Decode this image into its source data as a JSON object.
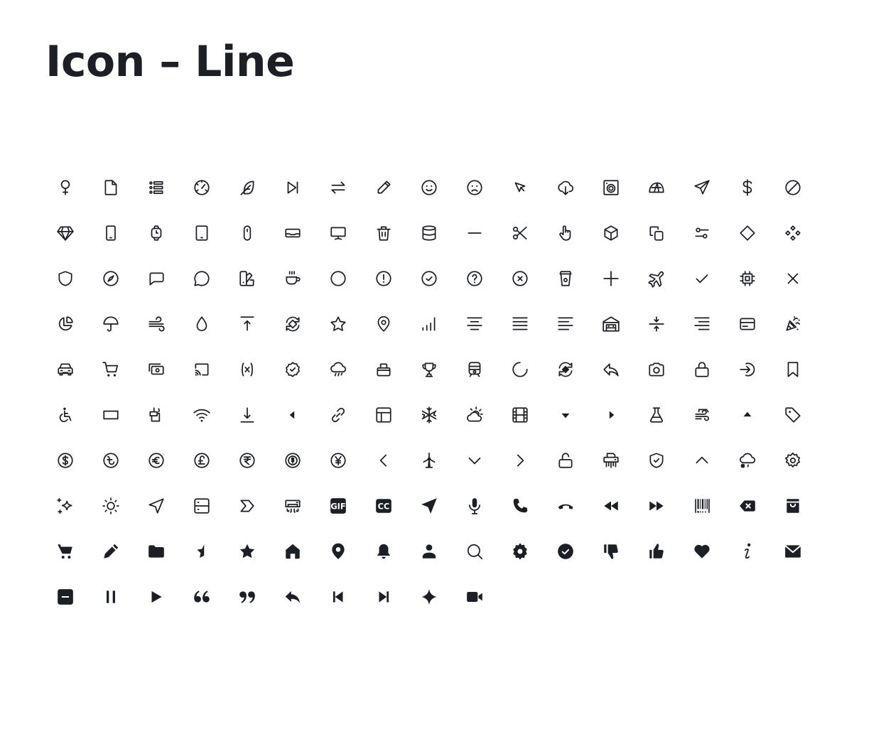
{
  "page": {
    "title": "Icon – Line"
  },
  "icons": [
    "female",
    "file",
    "list",
    "speedometer",
    "feather",
    "skip-forward",
    "transfer",
    "pencil",
    "smile",
    "frown",
    "cursor",
    "cloud-download",
    "washing-machine",
    "tent",
    "send",
    "dollar",
    "forbidden",
    "diamond-gem",
    "smartphone",
    "smartwatch",
    "tablet",
    "mouse",
    "inbox-tray",
    "monitor",
    "trash",
    "database",
    "minus",
    "scissors",
    "hand-pointer",
    "cube",
    "copy",
    "sliders",
    "rhombus",
    "apps-grid",
    "shield",
    "compass",
    "message-square",
    "message-circle",
    "swatch-book",
    "coffee-cup",
    "circle",
    "alert-circle",
    "check-circle",
    "help-circle",
    "x-circle",
    "takeaway-cup",
    "plus",
    "airplane",
    "check",
    "cpu-chip",
    "x",
    "pie-chart",
    "umbrella",
    "wind",
    "droplet",
    "upload-top",
    "sync-diamond",
    "star",
    "map-pin",
    "signal-bars",
    "align-center",
    "align-justify",
    "align-left",
    "garage",
    "collapse-vertical",
    "align-right",
    "credit-card",
    "party-popper",
    "car",
    "shopping-cart",
    "money-cash",
    "screencast",
    "variable",
    "verified-badge",
    "rain-cloud",
    "bag",
    "trophy",
    "train",
    "loader",
    "sync-grid",
    "reply",
    "camera",
    "lock",
    "login",
    "bookmark",
    "wheelchair",
    "rectangle",
    "drawer-pot",
    "wifi",
    "download-bottom",
    "caret-left",
    "link",
    "layout",
    "snowflake",
    "partly-sunny",
    "film",
    "caret-down",
    "caret-right",
    "beaker",
    "wind-line",
    "caret-up",
    "tag",
    "dollar-circle",
    "taka-circle",
    "euro-circle",
    "pound-circle",
    "rupee-circle",
    "dollar-exchange",
    "yen-circle",
    "chevron-left",
    "wind-turbine",
    "chevron-down",
    "chevron-right",
    "unlock",
    "shredder",
    "shield-check",
    "chevron-up",
    "snow-cloud",
    "settings",
    "sparkles",
    "sun",
    "navigation",
    "server",
    "chevron-sign",
    "air-conditioner",
    "gif-badge",
    "cc-badge",
    "send-filled",
    "microphone",
    "phone-filled",
    "phone-hangup",
    "rewind",
    "fast-forward",
    "barcode",
    "backspace",
    "shopping-bag-filled",
    "cart-filled",
    "pencil-filled",
    "folder-filled",
    "star-half-filled",
    "star-filled",
    "home-filled",
    "map-pin-filled",
    "bell-filled",
    "user-filled",
    "search-filled",
    "gear-filled",
    "check-circle-filled",
    "thumbs-down-filled",
    "thumbs-up-filled",
    "heart-filled",
    "info-italic",
    "mail-filled",
    "minus-square-filled",
    "pause",
    "play",
    "quote-open",
    "quote-close",
    "reply-filled",
    "skip-back-filled",
    "skip-forward-filled",
    "sparkle-filled",
    "video-filled"
  ],
  "labels": {
    "gif": "GIF",
    "cc": "CC"
  }
}
